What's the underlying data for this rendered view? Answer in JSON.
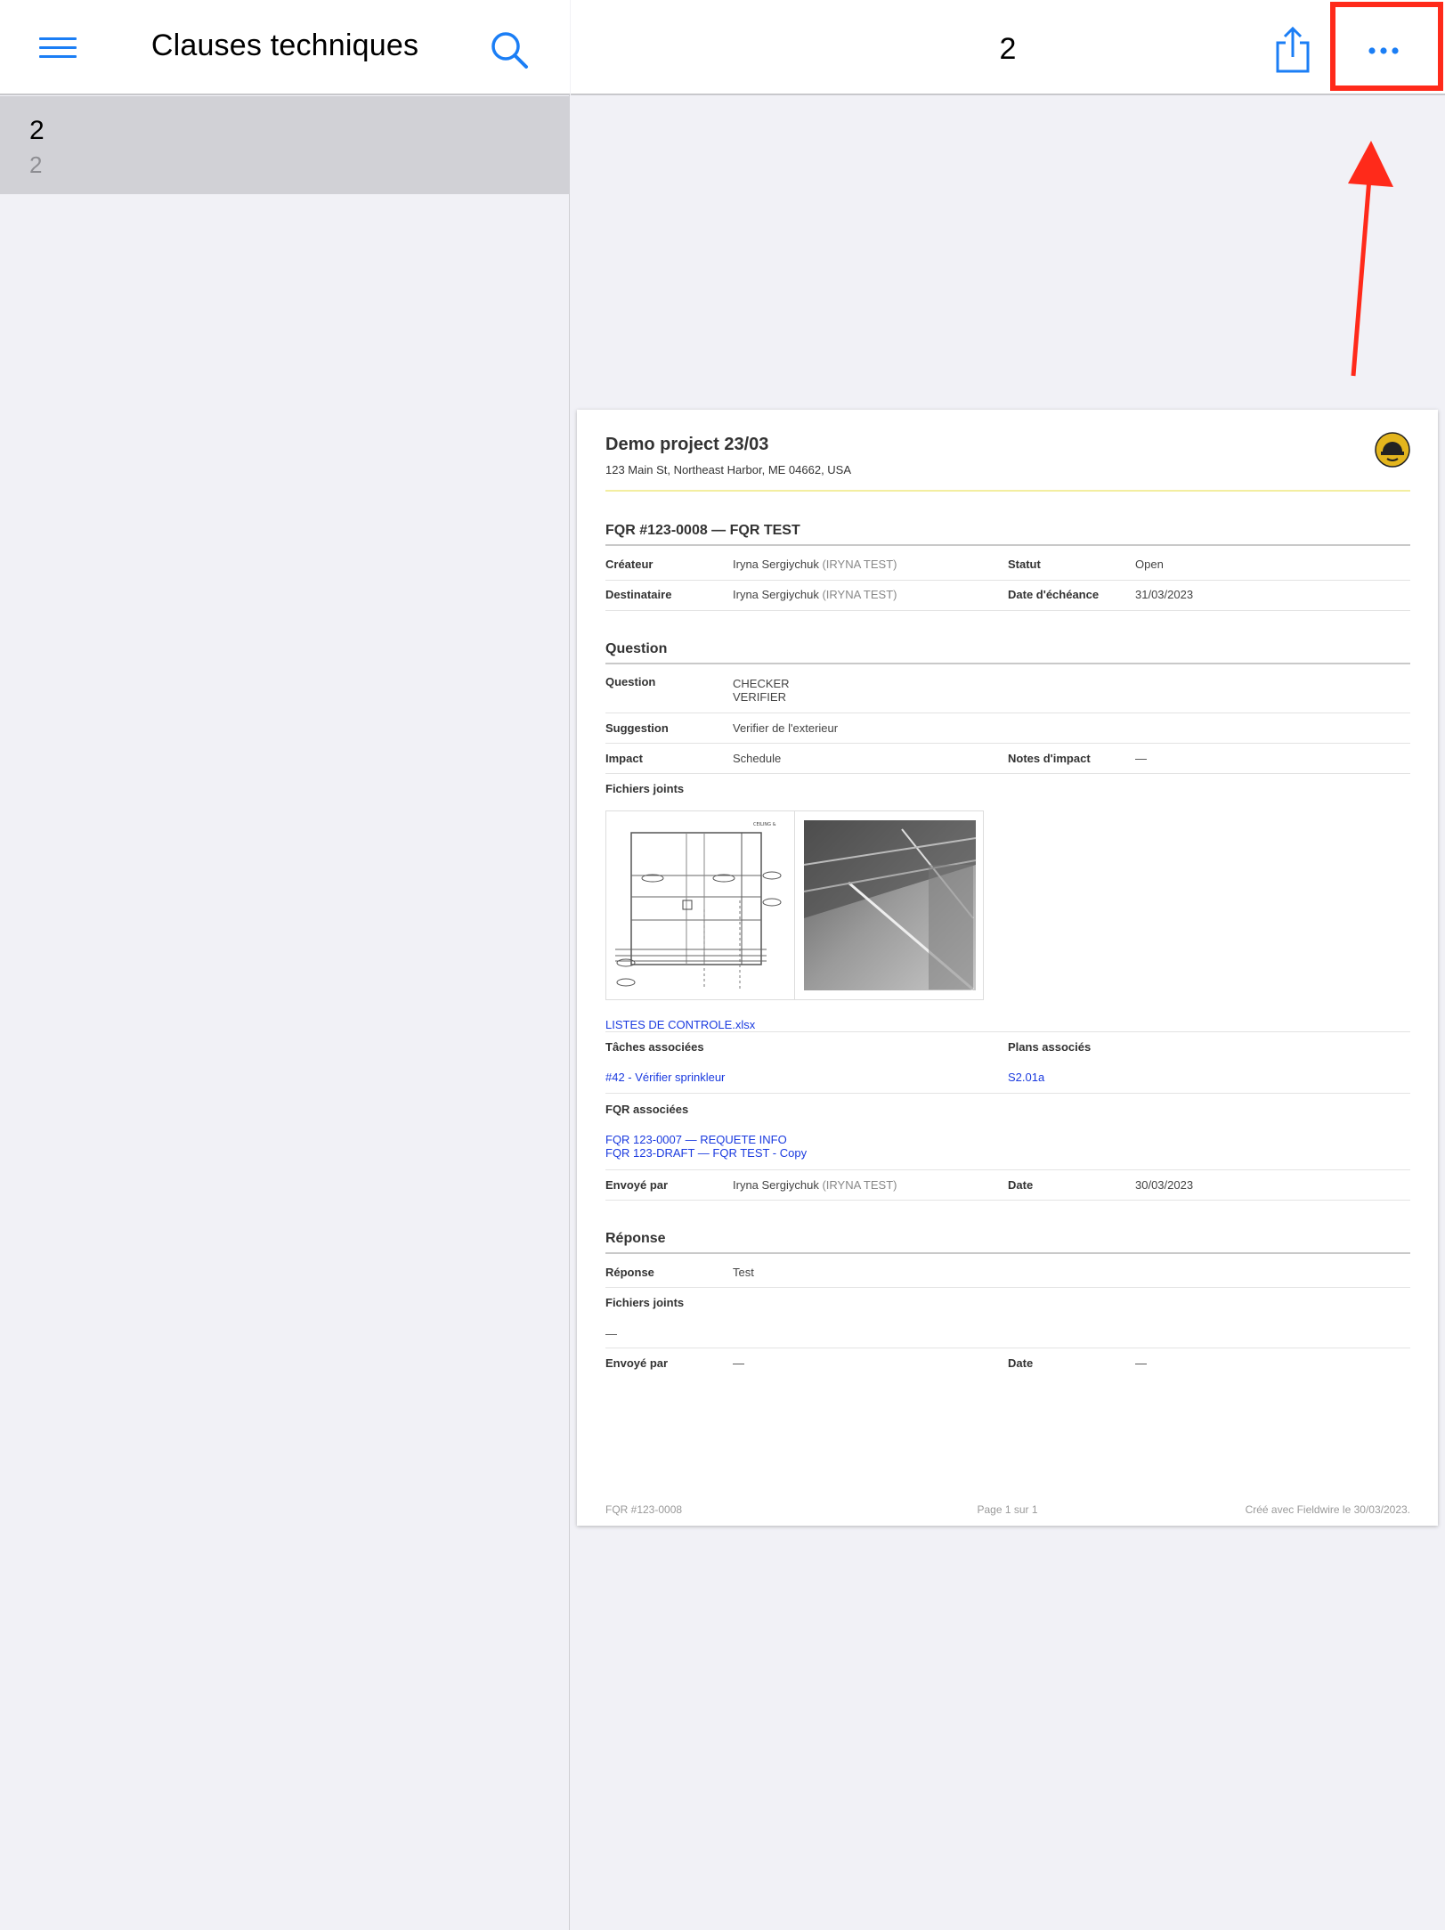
{
  "sidebar": {
    "title": "Clauses techniques",
    "items": [
      {
        "title": "2",
        "subtitle": "2"
      }
    ]
  },
  "header": {
    "title": "2"
  },
  "colors": {
    "accent": "#1b7ef5",
    "highlight": "#ff2a1a",
    "selected_row": "#d1d1d6"
  },
  "icons": [
    "hamburger-menu-icon",
    "search-icon",
    "share-icon",
    "more-icon"
  ],
  "document": {
    "project_name": "Demo project  23/03",
    "address": "123 Main St, Northeast Harbor, ME 04662, USA",
    "fqr_title": "FQR #123-0008 — FQR TEST",
    "creator_label": "Créateur",
    "creator_name": "Iryna Sergiychuk",
    "creator_org": "(IRYNA TEST)",
    "status_label": "Statut",
    "status_value": "Open",
    "recipient_label": "Destinataire",
    "recipient_name": "Iryna Sergiychuk",
    "recipient_org": "(IRYNA TEST)",
    "due_label": "Date d'échéance",
    "due_value": "31/03/2023",
    "question_section": "Question",
    "question_label": "Question",
    "question_line1": "CHECKER",
    "question_line2": "VERIFIER",
    "suggestion_label": "Suggestion",
    "suggestion_value": "Verifier de l'exterieur",
    "impact_label": "Impact",
    "impact_value": "Schedule",
    "impact_notes_label": "Notes d'impact",
    "impact_notes_value": "—",
    "attachments_label": "Fichiers joints",
    "attachment_file": "LISTES DE CONTROLE.xlsx",
    "tasks_label": "Tâches associées",
    "task_link": "#42 - Vérifier sprinkleur",
    "plans_label": "Plans associés",
    "plan_link": "S2.01a",
    "related_label": "FQR associées",
    "related_1": "FQR 123-0007 — REQUETE INFO",
    "related_2": "FQR 123-DRAFT — FQR TEST - Copy",
    "sent_by_label": "Envoyé par",
    "sent_by_name": "Iryna Sergiychuk",
    "sent_by_org": "(IRYNA TEST)",
    "date_label": "Date",
    "date_value": "30/03/2023",
    "response_section": "Réponse",
    "response_label": "Réponse",
    "response_value": "Test",
    "resp_attach_label": "Fichiers joints",
    "resp_attach_value": "—",
    "resp_sent_label": "Envoyé par",
    "resp_sent_value": "—",
    "resp_date_label": "Date",
    "resp_date_value": "—",
    "footer_left": "FQR #123-0008",
    "footer_center": "Page 1 sur 1",
    "footer_right": "Créé avec Fieldwire le 30/03/2023."
  }
}
